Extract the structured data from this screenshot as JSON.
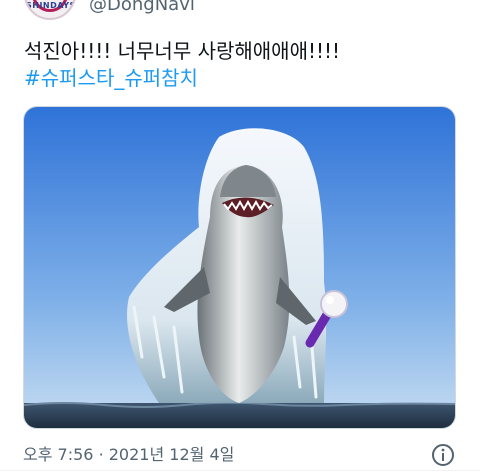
{
  "profile": {
    "avatar_text": "SHINDAYS",
    "handle": "@DongNavi"
  },
  "tweet": {
    "text_line1": "석진아!!!! 너무너무 사랑해애애애!!!!",
    "hashtags": [
      "#슈퍼스타",
      "_",
      "슈퍼참치"
    ],
    "media": {
      "alt": "shark leaping out of the ocean with a purple light stick"
    },
    "time": "오후 7:56",
    "separator": "·",
    "date": "2021년 12월 4일"
  },
  "icons": {
    "info": "info-icon"
  },
  "colors": {
    "link": "#1d9bf0",
    "text": "#0f1419",
    "muted": "#536471",
    "sky_top": "#2f73d8",
    "sky_bottom": "#bcd8f2",
    "sea": "#2a3d52",
    "lightstick": "#6a2ab0"
  }
}
